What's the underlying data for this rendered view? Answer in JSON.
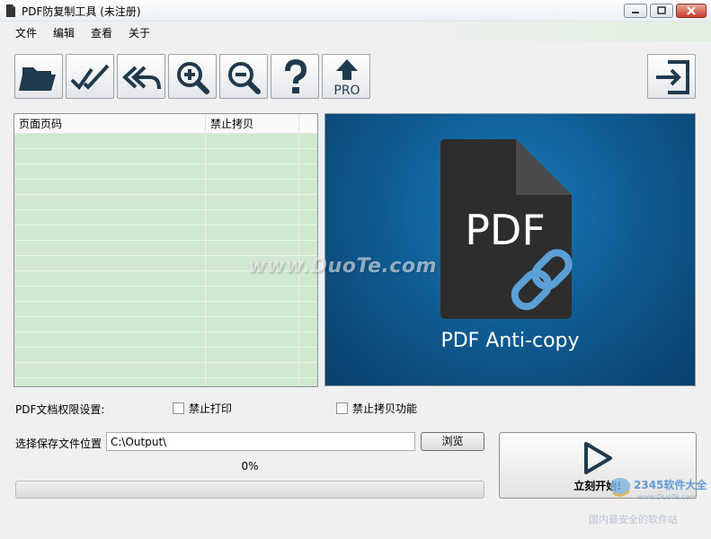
{
  "window": {
    "title": "PDF防复制工具 (未注册)",
    "controls": [
      "minimize",
      "maximize",
      "close"
    ]
  },
  "menu": {
    "file": "文件",
    "edit": "编辑",
    "view": "查看",
    "about": "关于"
  },
  "toolbar": {
    "icons": [
      "folder-open-icon",
      "double-check-icon",
      "reply-all-icon",
      "zoom-in-icon",
      "zoom-out-icon",
      "help-icon",
      "pro-upgrade-icon",
      "exit-icon"
    ],
    "pro_label": "PRO"
  },
  "file_list": {
    "columns": [
      "页面页码",
      "禁止拷贝"
    ],
    "rows": []
  },
  "preview": {
    "doc_label": "PDF",
    "caption": "PDF Anti-copy"
  },
  "watermark": "www.DuoTe.com",
  "settings": {
    "permissions_label": "PDF文档权限设置:",
    "disable_print": {
      "label": "禁止打印",
      "checked": false
    },
    "disable_copy": {
      "label": "禁止拷贝功能",
      "checked": false
    }
  },
  "output": {
    "label": "选择保存文件位置",
    "path": "C:\\Output\\",
    "browse_label": "浏览"
  },
  "progress": {
    "text": "0%",
    "value": 0
  },
  "start": {
    "label": "立刻开始!"
  },
  "brand": {
    "logo_text": "2345软件大全",
    "url": "www.DuoTe.com",
    "caption": "国内最安全的软件站"
  },
  "colors": {
    "list_bg": "#cfe8cf",
    "preview_blue": "#0f5e96",
    "icon_dark": "#1f3a4d"
  }
}
